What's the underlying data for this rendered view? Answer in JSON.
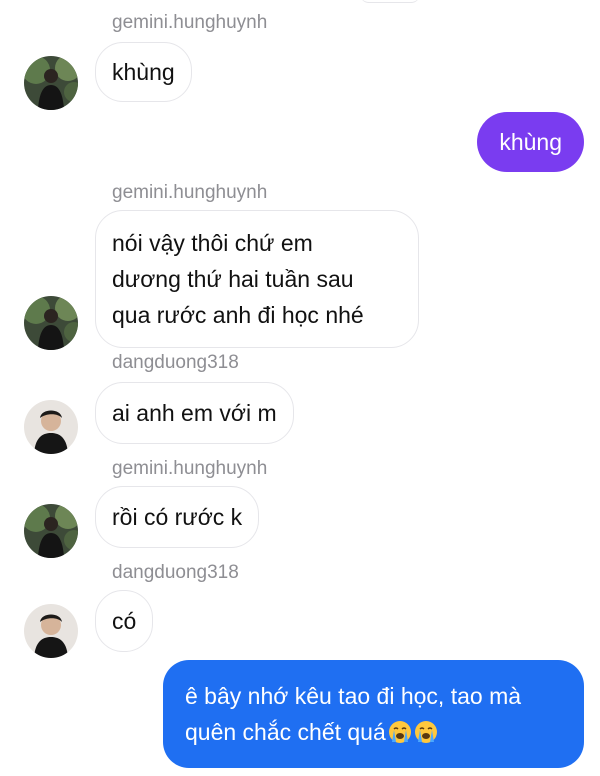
{
  "messages": [
    {
      "sender": "gemini.hunghuynh",
      "text": "khùng"
    },
    {
      "self_text": "khùng"
    },
    {
      "sender": "gemini.hunghuynh",
      "text": "nói vậy thôi chứ em\ndương thứ hai tuần sau\nqua rước anh đi học nhé"
    },
    {
      "sender": "dangduong318",
      "text": "ai anh em với m"
    },
    {
      "sender": "gemini.hunghuynh",
      "text": "rồi có rước k"
    },
    {
      "sender": "dangduong318",
      "text": "có"
    },
    {
      "self_text": "ê bây nhớ kêu tao đi học, tao mà quên chắc chết quá"
    }
  ],
  "colors": {
    "self_purple": "#7a3cf0",
    "self_blue": "#1f6ff2",
    "sender_name": "#8e8e93"
  },
  "icons": {
    "avatar_gemini": "avatar-gemini-hunghuynh",
    "avatar_dang": "avatar-dangduong318",
    "emoji": "loudly-crying-face-emoji"
  }
}
